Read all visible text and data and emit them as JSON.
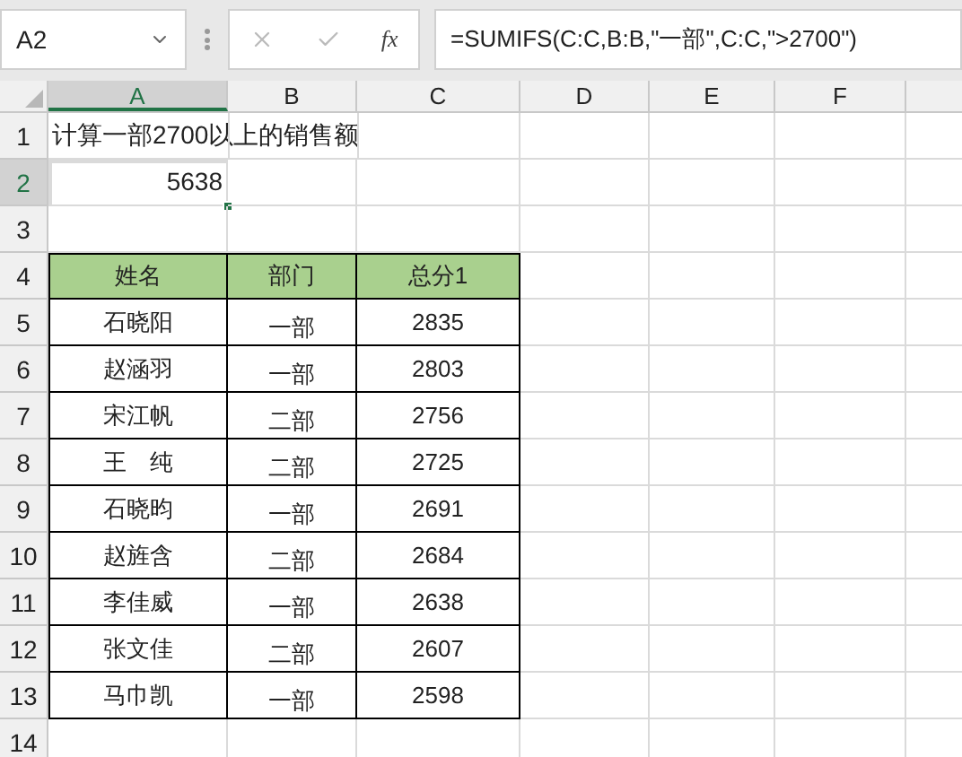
{
  "name_box": {
    "value": "A2"
  },
  "formula_bar": {
    "fx": "fx",
    "formula": "=SUMIFS(C:C,B:B,\"一部\",C:C,\">2700\")"
  },
  "sheet": {
    "columns": [
      {
        "label": "A",
        "selected": true
      },
      {
        "label": "B",
        "selected": false
      },
      {
        "label": "C",
        "selected": false
      },
      {
        "label": "D",
        "selected": false
      },
      {
        "label": "E",
        "selected": false
      },
      {
        "label": "F",
        "selected": false
      }
    ],
    "rows": [
      {
        "label": "1",
        "selected": false,
        "kind": "text",
        "cells": [
          "计算一部2700以上的销售额"
        ]
      },
      {
        "label": "2",
        "selected": true,
        "kind": "value",
        "cells": [
          "5638"
        ]
      },
      {
        "label": "3",
        "selected": false,
        "kind": "empty",
        "cells": []
      },
      {
        "label": "4",
        "selected": false,
        "kind": "header",
        "cells": [
          "姓名",
          "部门",
          "总分1"
        ]
      },
      {
        "label": "5",
        "selected": false,
        "kind": "data",
        "cells": [
          "石晓阳",
          "一部",
          "2835"
        ]
      },
      {
        "label": "6",
        "selected": false,
        "kind": "data",
        "cells": [
          "赵涵羽",
          "一部",
          "2803"
        ]
      },
      {
        "label": "7",
        "selected": false,
        "kind": "data",
        "cells": [
          "宋江帆",
          "二部",
          "2756"
        ]
      },
      {
        "label": "8",
        "selected": false,
        "kind": "data",
        "cells": [
          "王　纯",
          "二部",
          "2725"
        ]
      },
      {
        "label": "9",
        "selected": false,
        "kind": "data",
        "cells": [
          "石晓昀",
          "一部",
          "2691"
        ]
      },
      {
        "label": "10",
        "selected": false,
        "kind": "data",
        "cells": [
          "赵旌含",
          "二部",
          "2684"
        ]
      },
      {
        "label": "11",
        "selected": false,
        "kind": "data",
        "cells": [
          "李佳威",
          "一部",
          "2638"
        ]
      },
      {
        "label": "12",
        "selected": false,
        "kind": "data",
        "cells": [
          "张文佳",
          "二部",
          "2607"
        ]
      },
      {
        "label": "13",
        "selected": false,
        "kind": "data",
        "cells": [
          "马巾凯",
          "一部",
          "2598"
        ]
      },
      {
        "label": "14",
        "selected": false,
        "kind": "empty",
        "cells": []
      }
    ]
  }
}
